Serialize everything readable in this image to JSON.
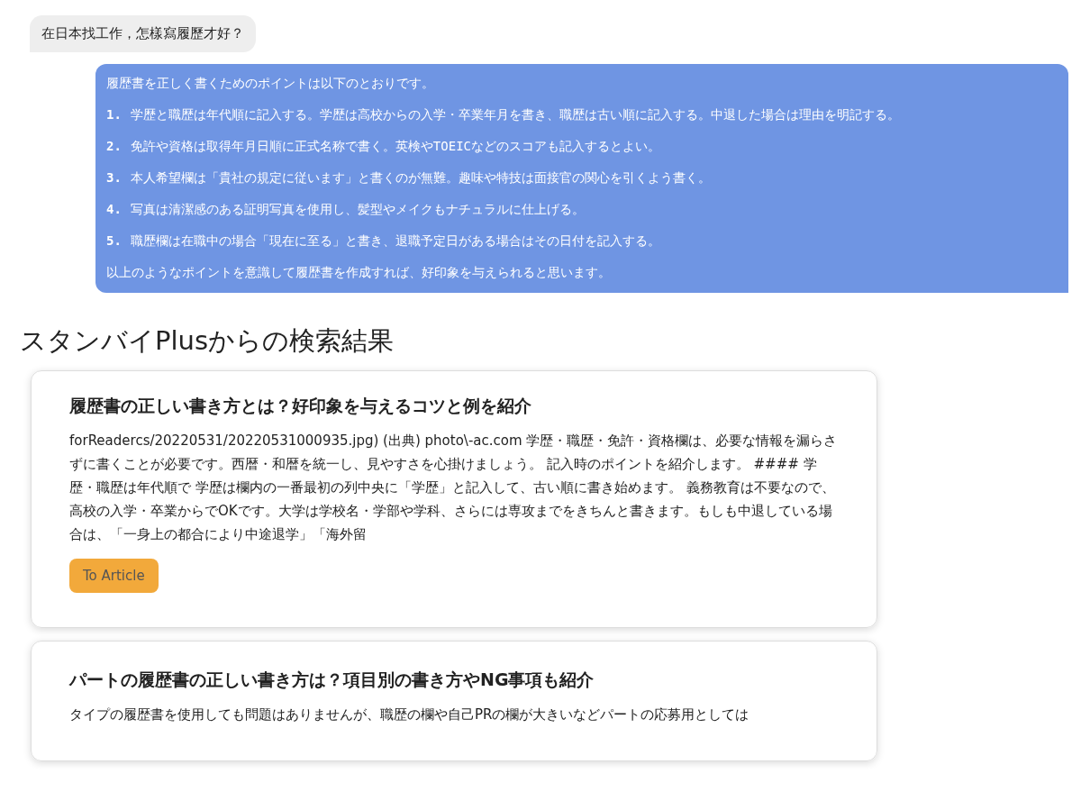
{
  "user_message": "在日本找工作，怎樣寫履歷才好？",
  "reply": {
    "intro": "履歴書を正しく書くためのポイントは以下のとおりです。",
    "points": [
      {
        "number": "1.",
        "text": "学歴と職歴は年代順に記入する。学歴は高校からの入学・卒業年月を書き、職歴は古い順に記入する。中退した場合は理由を明記する。"
      },
      {
        "number": "2.",
        "text": "免許や資格は取得年月日順に正式名称で書く。英検やTOEICなどのスコアも記入するとよい。"
      },
      {
        "number": "3.",
        "text": "本人希望欄は「貴社の規定に従います」と書くのが無難。趣味や特技は面接官の関心を引くよう書く。"
      },
      {
        "number": "4.",
        "text": "写真は清潔感のある証明写真を使用し、髪型やメイクもナチュラルに仕上げる。"
      },
      {
        "number": "5.",
        "text": "職歴欄は在職中の場合「現在に至る」と書き、退職予定日がある場合はその日付を記入する。"
      }
    ],
    "closing": "以上のようなポイントを意識して履歴書を作成すれば、好印象を与えられると思います。"
  },
  "results": {
    "heading": "スタンバイPlusからの検索結果",
    "cards": [
      {
        "title": "履歴書の正しい書き方とは？好印象を与えるコツと例を紹介",
        "snippet": "forReadercs/20220531/20220531000935.jpg) (出典) photo\\-ac.com 学歴・職歴・免許・資格欄は、必要な情報を漏らさずに書くことが必要です。西暦・和暦を統一し、見やすさを心掛けましょう。 記入時のポイントを紹介します。 #### 学歴・職歴は年代順で 学歴は欄内の一番最初の列中央に「学歴」と記入して、古い順に書き始めます。 義務教育は不要なので、高校の入学・卒業からでOKです。大学は学校名・学部や学科、さらには専攻までをきちんと書きます。もしも中退している場合は、「一身上の都合により中途退学」「海外留",
        "button": "To Article"
      },
      {
        "title": "パートの履歴書の正しい書き方は？項目別の書き方やNG事項も紹介",
        "snippet": "タイプの履歴書を使用しても問題はありませんが、職歴の欄や自己PRの欄が大きいなどパートの応募用としては"
      }
    ]
  }
}
